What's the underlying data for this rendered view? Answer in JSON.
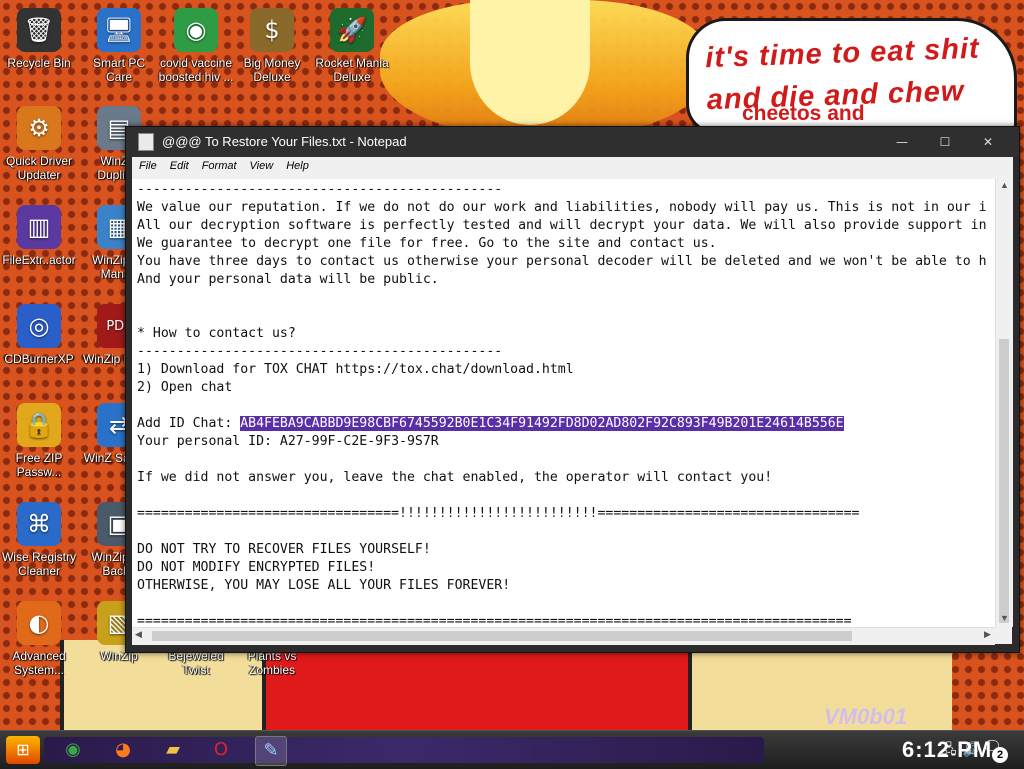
{
  "wallpaper": {
    "bubble_line1": "it's time to eat shit",
    "bubble_line2": "and die and chew",
    "bubble_line3": "cheetos and",
    "watermark": "VM0b01"
  },
  "desktop_icons": [
    {
      "label": "Recycle Bin",
      "icon": "recycle-bin-icon",
      "glyph": "🗑",
      "color": "#333333"
    },
    {
      "label": "Smart PC Care",
      "icon": "smart-pc-care-icon",
      "glyph": "🖥",
      "color": "#2a72c9"
    },
    {
      "label": "covid vaccine boosted hiv ...",
      "icon": "chrome-icon",
      "glyph": "◉",
      "color": "#2e9b45"
    },
    {
      "label": "Big Money Deluxe",
      "icon": "money-bag-icon",
      "glyph": "$",
      "color": "#8a6a2a"
    },
    {
      "label": "Rocket Mania Deluxe",
      "icon": "rocket-icon",
      "glyph": "🚀",
      "color": "#1f6b2d"
    },
    {
      "label": "Quick Driver Updater",
      "icon": "driver-updater-icon",
      "glyph": "⚙",
      "color": "#d9771c"
    },
    {
      "label": "WinZip Duplicat",
      "icon": "winzip-icon",
      "glyph": "▤",
      "color": "#6a7a8a"
    },
    {
      "label": "FileExtr..actor",
      "icon": "file-extractor-icon",
      "glyph": "▥",
      "color": "#5a3aa0"
    },
    {
      "label": "WinZip Im Manag",
      "icon": "winzip-image-icon",
      "glyph": "▦",
      "color": "#3c82c8"
    },
    {
      "label": "CDBurnerXP",
      "icon": "cdburner-icon",
      "glyph": "◎",
      "color": "#2a5fc9"
    },
    {
      "label": "WinZip Expre",
      "icon": "pdf-icon",
      "glyph": "PDF",
      "color": "#a01a1a"
    },
    {
      "label": "Free ZIP Passw...",
      "icon": "zip-password-icon",
      "glyph": "🔒",
      "color": "#e0a81a"
    },
    {
      "label": "WinZ SafeSh",
      "icon": "safeshare-icon",
      "glyph": "⇄",
      "color": "#2a72c9"
    },
    {
      "label": "Wise Registry Cleaner",
      "icon": "registry-cleaner-icon",
      "glyph": "⌘",
      "color": "#2a6ac9"
    },
    {
      "label": "WinZip Se Backu",
      "icon": "backup-icon",
      "glyph": "▣",
      "color": "#4a5a6a"
    },
    {
      "label": "Advanced System...",
      "icon": "advanced-system-care-icon",
      "glyph": "◐",
      "color": "#e06a1a"
    },
    {
      "label": "WinZip",
      "icon": "winzip-main-icon",
      "glyph": "▧",
      "color": "#c9a01a"
    },
    {
      "label": "Bejeweled Twist",
      "icon": "bejeweled-icon",
      "glyph": "◆",
      "color": "#aa3ad0"
    },
    {
      "label": "Plants vs Zombies",
      "icon": "plants-vs-zombies-icon",
      "glyph": "✿",
      "color": "#3a9a2a"
    }
  ],
  "notepad": {
    "title": "@@@ To Restore Your Files.txt - Notepad",
    "menu": [
      "File",
      "Edit",
      "Format",
      "View",
      "Help"
    ],
    "lines": [
      "----------------------------------------------",
      "We value our reputation. If we do not do our work and liabilities, nobody will pay us. This is not in our i",
      "All our decryption software is perfectly tested and will decrypt your data. We will also provide support in",
      "We guarantee to decrypt one file for free. Go to the site and contact us.",
      "You have three days to contact us otherwise your personal decoder will be deleted and we won't be able to h",
      "And your personal data will be public.",
      "",
      "",
      "* How to contact us?",
      "----------------------------------------------",
      "1) Download for TOX CHAT https://tox.chat/download.html",
      "2) Open chat",
      ""
    ],
    "chat_id_label": "Add ID Chat: ",
    "chat_id": "AB4FEBA9CABBD9E98CBF6745592B0E1C34F91492FD8D02AD802F92C893F49B201E24614B556E",
    "lines_after": [
      "Your personal ID: A27-99F-C2E-9F3-9S7R",
      "",
      "If we did not answer you, leave the chat enabled, the operator will contact you!",
      "",
      "=================================!!!!!!!!!!!!!!!!!!!!!!!!!=================================",
      "",
      "DO NOT TRY TO RECOVER FILES YOURSELF!",
      "DO NOT MODIFY ENCRYPTED FILES!",
      "OTHERWISE, YOU MAY LOSE ALL YOUR FILES FOREVER!",
      "",
      "=========================================================================================="
    ]
  },
  "taskbar": {
    "clock": "6:12 PM",
    "notifications": "2",
    "apps": [
      {
        "name": "chrome",
        "glyph": "◉",
        "color": "#3aa54a"
      },
      {
        "name": "firefox",
        "glyph": "◕",
        "color": "#ff7a1a"
      },
      {
        "name": "file-explorer",
        "glyph": "▰",
        "color": "#f0c24a"
      },
      {
        "name": "opera",
        "glyph": "O",
        "color": "#e0202a"
      },
      {
        "name": "notepad",
        "glyph": "✎",
        "color": "#9ad0ff"
      }
    ]
  }
}
